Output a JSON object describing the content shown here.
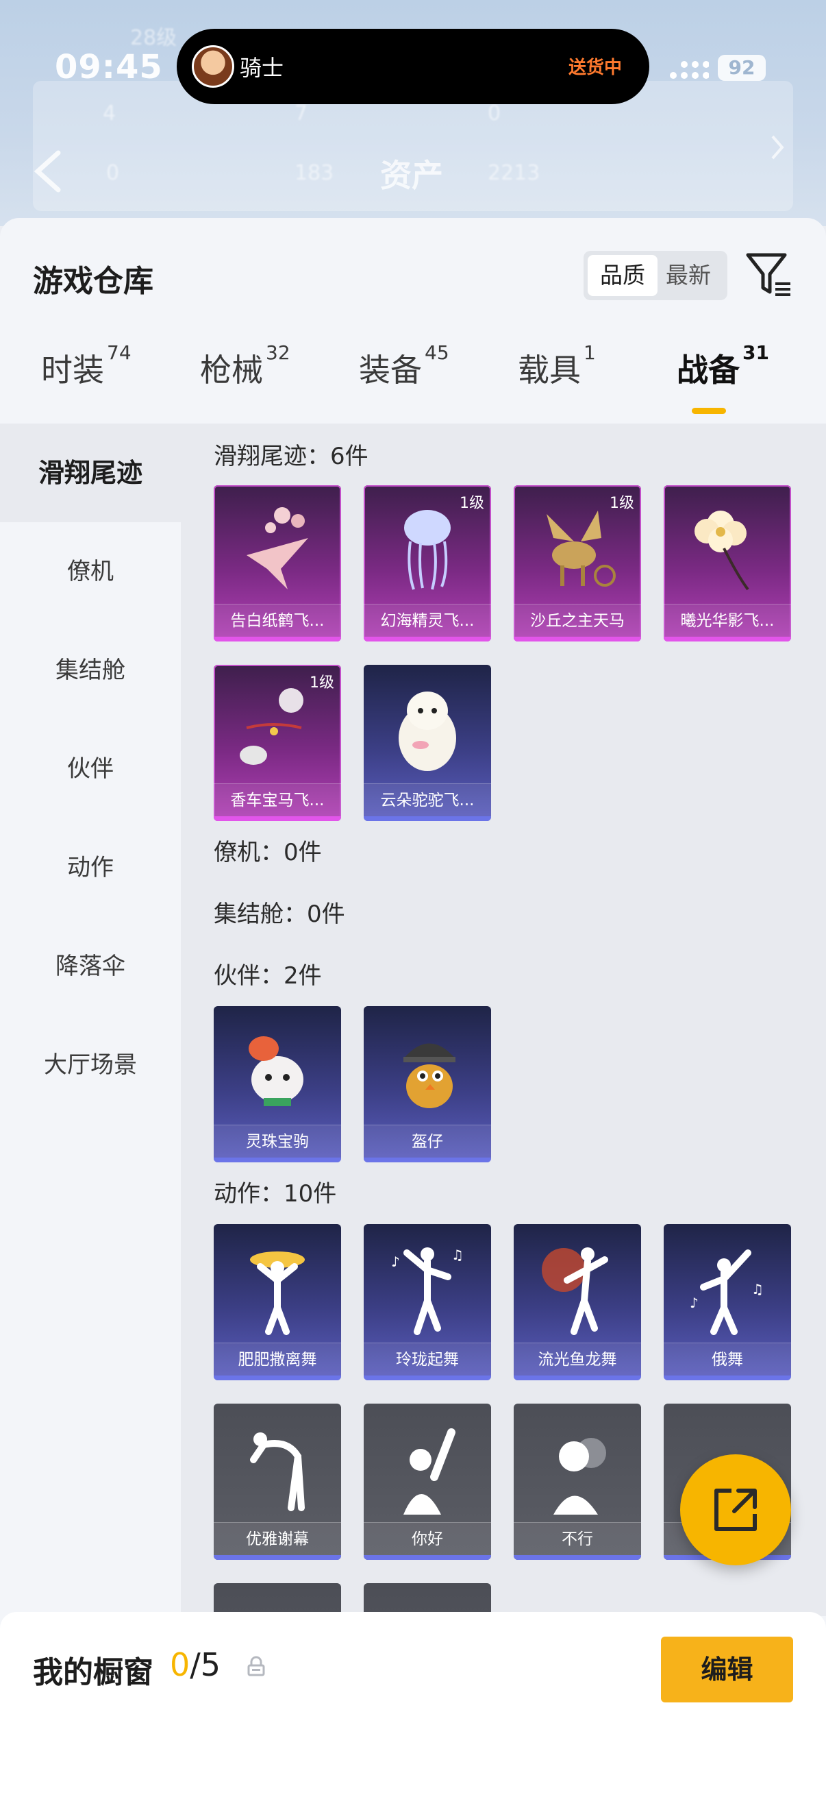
{
  "status": {
    "time": "09:45",
    "battery": "92"
  },
  "island": {
    "name": "骑士",
    "status": "送货中"
  },
  "background": {
    "title": "资产",
    "r1": [
      "4",
      "7",
      "0"
    ],
    "r2": [
      "0",
      "183",
      "2213"
    ],
    "level": "28级"
  },
  "header": {
    "title": "游戏仓库",
    "sort": [
      "品质",
      "最新"
    ]
  },
  "tabs": [
    {
      "label": "时装",
      "count": "74"
    },
    {
      "label": "枪械",
      "count": "32"
    },
    {
      "label": "装备",
      "count": "45"
    },
    {
      "label": "载具",
      "count": "1"
    },
    {
      "label": "战备",
      "count": "31"
    }
  ],
  "nav": [
    "滑翔尾迹",
    "僚机",
    "集结舱",
    "伙伴",
    "动作",
    "降落伞",
    "大厅场景"
  ],
  "sections": {
    "glide": "滑翔尾迹：6件",
    "wingman": "僚机：0件",
    "pod": "集结舱：0件",
    "partner": "伙伴：2件",
    "action": "动作：10件"
  },
  "glide_items": [
    {
      "name": "告白纸鹤飞...",
      "level": ""
    },
    {
      "name": "幻海精灵飞...",
      "level": "1级"
    },
    {
      "name": "沙丘之主天马",
      "level": "1级"
    },
    {
      "name": "曦光华影飞...",
      "level": ""
    },
    {
      "name": "香车宝马飞...",
      "level": "1级"
    },
    {
      "name": "云朵驼驼飞...",
      "level": ""
    }
  ],
  "partner_items": [
    "灵珠宝驹",
    "盔仔"
  ],
  "action_items": [
    "肥肥撒离舞",
    "玲珑起舞",
    "流光鱼龙舞",
    "俄舞",
    "优雅谢幕",
    "你好",
    "不行",
    ""
  ],
  "bottom": {
    "title": "我的橱窗",
    "count_zero": "0",
    "count_rest": "/5",
    "edit": "编辑"
  }
}
